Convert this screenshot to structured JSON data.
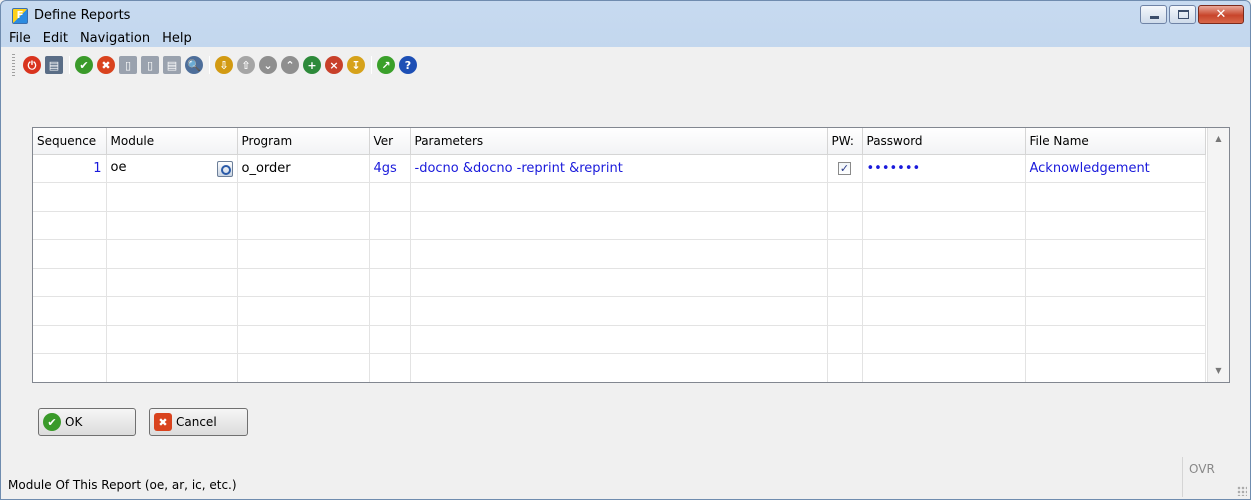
{
  "window": {
    "title": "Define Reports",
    "app_icon_letter": "F"
  },
  "menu": [
    "File",
    "Edit",
    "Navigation",
    "Help"
  ],
  "toolbar": {
    "icons": [
      {
        "name": "power-icon",
        "color": "#d9341e",
        "glyph": "⏻"
      },
      {
        "name": "save-disk-icon",
        "color": "#5a6d86",
        "glyph": "▤",
        "square": true
      },
      {
        "sep": true
      },
      {
        "name": "accept-icon",
        "color": "#3a9a2a",
        "glyph": "✔"
      },
      {
        "name": "reject-icon",
        "color": "#d9431e",
        "glyph": "✖"
      },
      {
        "name": "copy-record-icon",
        "color": "#9aa2ae",
        "glyph": "▯",
        "square": true
      },
      {
        "name": "paste-record-icon",
        "color": "#9aa2ae",
        "glyph": "▯",
        "square": true
      },
      {
        "name": "list-icon",
        "color": "#9aa2ae",
        "glyph": "▤",
        "square": true
      },
      {
        "name": "search-icon",
        "color": "#4d6e9a",
        "glyph": "🔍"
      },
      {
        "sep": true
      },
      {
        "name": "import-icon",
        "color": "#d29a12",
        "glyph": "⇩"
      },
      {
        "name": "export-icon",
        "color": "#a5a5a5",
        "glyph": "⇧"
      },
      {
        "name": "move-down-icon",
        "color": "#8f8f8f",
        "glyph": "⌄"
      },
      {
        "name": "move-up-icon",
        "color": "#8f8f8f",
        "glyph": "⌃"
      },
      {
        "name": "insert-row-icon",
        "color": "#2d8a3a",
        "glyph": "+"
      },
      {
        "name": "delete-row-icon",
        "color": "#c8402a",
        "glyph": "×"
      },
      {
        "name": "sort-icon",
        "color": "#d6a21a",
        "glyph": "↧"
      },
      {
        "sep": true
      },
      {
        "name": "run-icon",
        "color": "#3aa02a",
        "glyph": "↗"
      },
      {
        "name": "help-icon",
        "color": "#1d4fb5",
        "glyph": "?"
      }
    ]
  },
  "grid": {
    "headers": [
      "Sequence",
      "Module",
      "Program",
      "Ver",
      "Parameters",
      "PW:",
      "Password",
      "File Name"
    ],
    "rows": [
      {
        "sequence": "1",
        "module": "oe",
        "program": "o_order",
        "ver": "4gs",
        "parameters": "-docno &docno -reprint &reprint",
        "pw_checked": true,
        "password": "•••••••",
        "file_name": "Acknowledgement"
      }
    ],
    "empty_rows": 7,
    "check_glyph": "✓"
  },
  "buttons": {
    "ok": "OK",
    "cancel": "Cancel"
  },
  "status": {
    "text": "Module Of This Report (oe, ar, ic, etc.)",
    "mode": "OVR"
  },
  "colors": {
    "link_text": "#1a1adb",
    "title_bar": "#c3d7ee"
  }
}
